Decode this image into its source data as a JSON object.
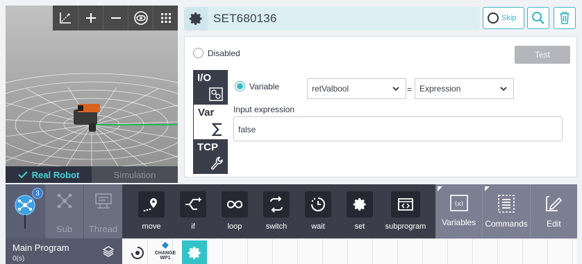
{
  "viewport": {
    "tool_icons": [
      "axis-icon",
      "zoom-in-icon",
      "zoom-out-icon",
      "eye-icon",
      "grid-menu-icon"
    ],
    "modes": {
      "real": "Real Robot",
      "simulation": "Simulation"
    }
  },
  "command": {
    "name": "SET680136",
    "skip_label": "Skip"
  },
  "panel": {
    "disabled_label": "Disabled",
    "test_label": "Test",
    "side_tabs": [
      {
        "label": "I/O",
        "icon": "io-icon"
      },
      {
        "label": "Var",
        "icon": "sigma-icon"
      },
      {
        "label": "TCP",
        "icon": "wrench-icon"
      }
    ],
    "variable_label": "Variable",
    "variable_value": "retValbool",
    "operator": "=",
    "expression_type": "Expression",
    "input_expression_label": "Input expression",
    "input_expression_value": "false"
  },
  "program_tabs": [
    {
      "label": "",
      "badge": "3"
    },
    {
      "label": "Sub"
    },
    {
      "label": "Thread"
    }
  ],
  "main_program": {
    "title": "Main Program",
    "subtitle": "0(s)"
  },
  "commands": [
    "move",
    "if",
    "loop",
    "switch",
    "wait",
    "set",
    "subprogram"
  ],
  "tools": [
    "Variables",
    "Commands",
    "Edit"
  ],
  "timeline": {
    "change_label_1": "CHANGE",
    "change_label_2": "WP1"
  },
  "colors": {
    "accent": "#3bb8c4",
    "dark": "#3b3e4a",
    "active_cmd": "#31c3c8"
  }
}
